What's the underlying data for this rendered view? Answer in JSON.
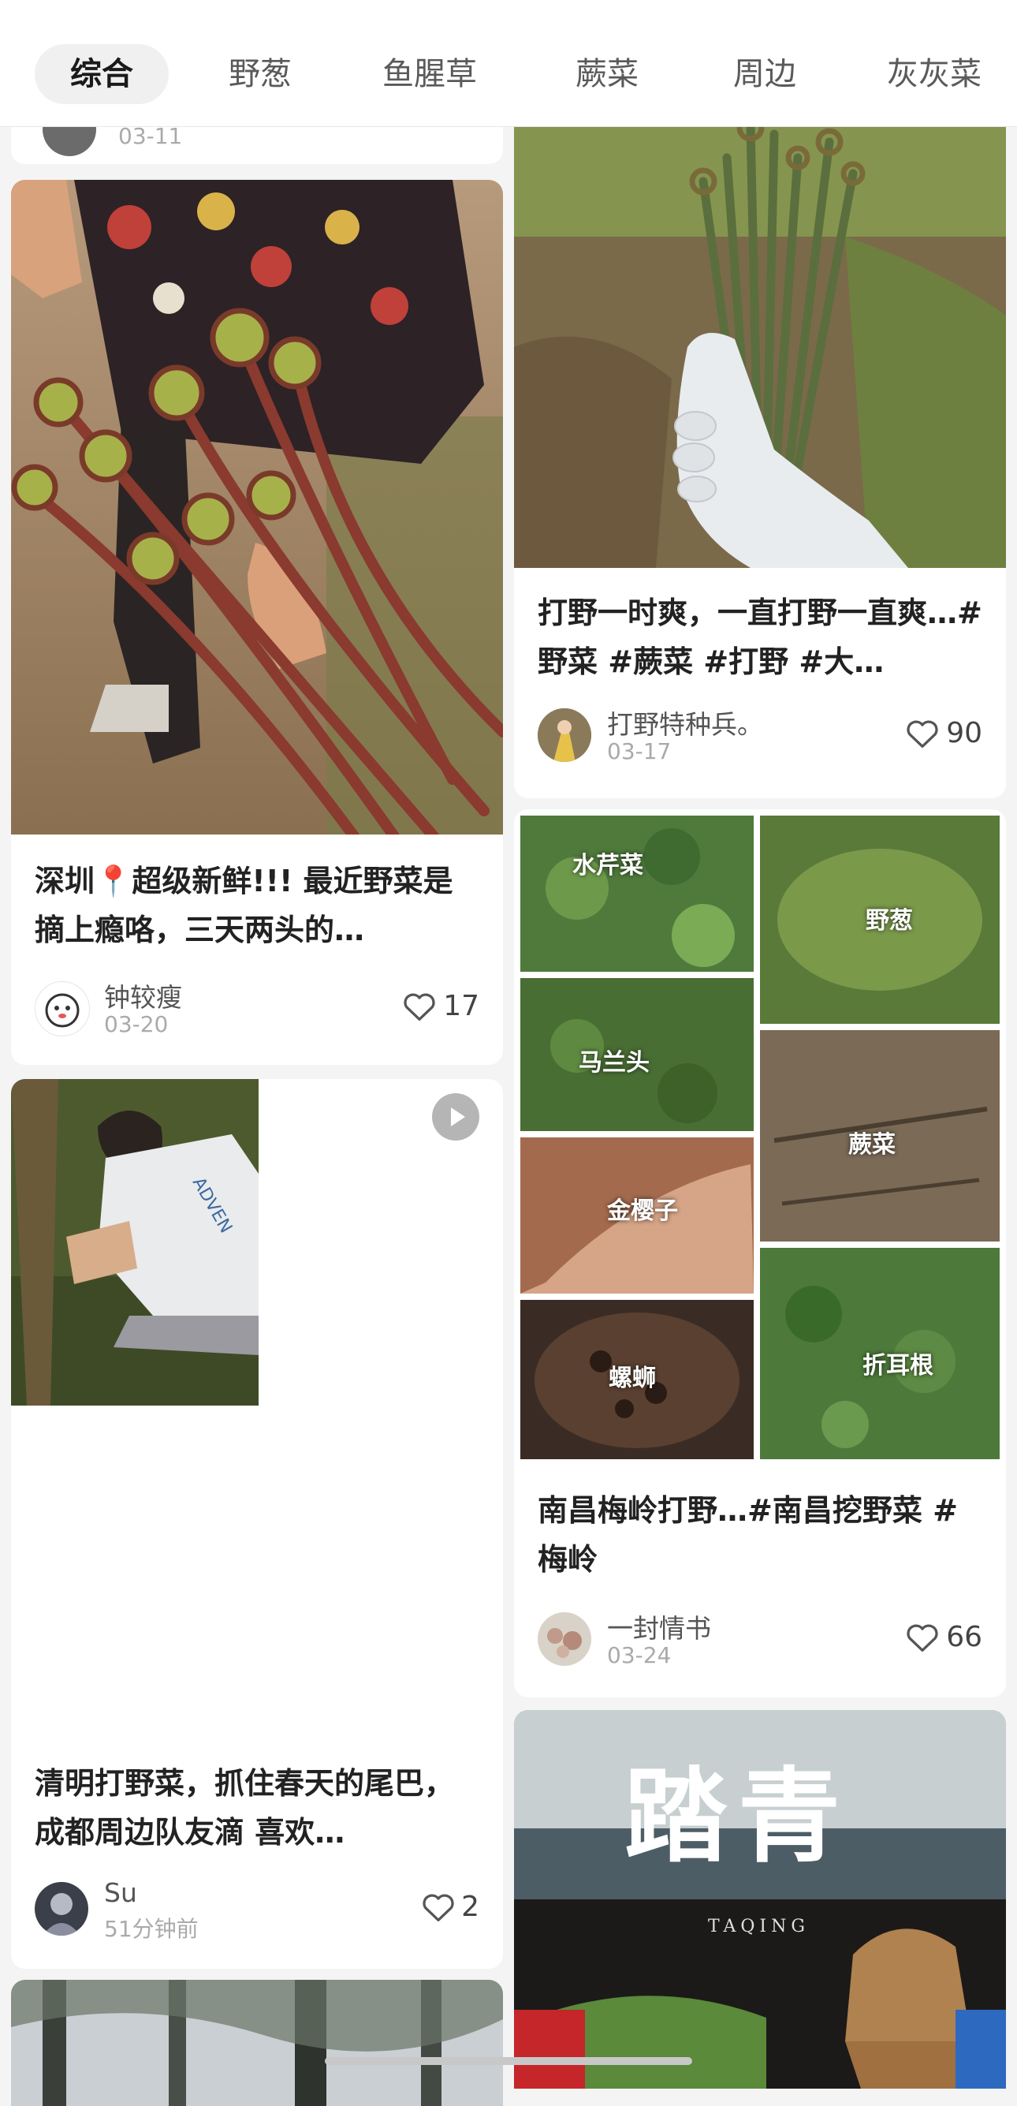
{
  "tabs": [
    "综合",
    "野葱",
    "鱼腥草",
    "蕨菜",
    "周边",
    "灰灰菜"
  ],
  "top_stub": {
    "date": "03-11"
  },
  "cards": {
    "fern": {
      "title": "深圳📍超级新鲜!!!  最近野菜是摘上瘾咯，三天两头的…",
      "author": "钟较瘦",
      "date": "03-20",
      "likes": "17"
    },
    "video": {
      "title": "清明打野菜，抓住春天的尾巴，成都周边队友滴 喜欢…",
      "author": "Su",
      "date": "51分钟前",
      "likes": "2"
    },
    "fern2": {
      "title": "打野一时爽，一直打野一直爽…#野菜 #蕨菜 #打野 #大…",
      "author": "打野特种兵。",
      "date": "03-17",
      "likes": "90"
    },
    "collage": {
      "title": "南昌梅岭打野…#南昌挖野菜 #梅岭",
      "author": "一封情书",
      "date": "03-24",
      "likes": "66",
      "labels": [
        "水芹菜",
        "野葱",
        "马兰头",
        "蕨菜",
        "金樱子",
        "螺蛳",
        "折耳根"
      ]
    },
    "taqing": {
      "big": "踏青",
      "small": "TAQING"
    }
  },
  "icons": {
    "like": "heart-icon",
    "play": "play-icon"
  },
  "colors": {
    "tab_active_bg": "#f0f0f0",
    "background": "#f4f4f4"
  }
}
